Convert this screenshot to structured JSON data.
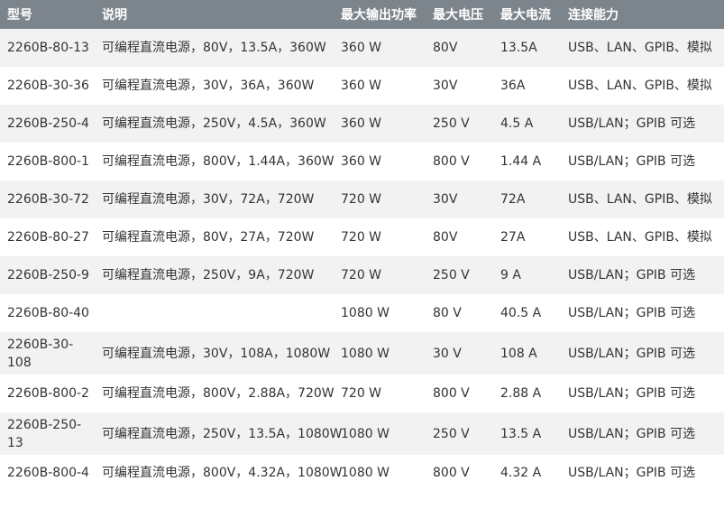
{
  "headers": [
    "型号",
    "说明",
    "最大输出功率",
    "最大电压",
    "最大电流",
    "连接能力"
  ],
  "rows": [
    [
      "2260B-80-13",
      "可编程直流电源，80V，13.5A，360W",
      "360 W",
      "80V",
      "13.5A",
      "USB、LAN、GPIB、模拟"
    ],
    [
      "2260B-30-36",
      "可编程直流电源，30V，36A，360W",
      "360 W",
      "30V",
      "36A",
      "USB、LAN、GPIB、模拟"
    ],
    [
      "2260B-250-4",
      "可编程直流电源，250V，4.5A，360W",
      "360 W",
      "250 V",
      "4.5 A",
      "USB/LAN；GPIB 可选"
    ],
    [
      "2260B-800-1",
      "可编程直流电源，800V，1.44A，360W",
      "360 W",
      "800 V",
      "1.44 A",
      "USB/LAN；GPIB 可选"
    ],
    [
      "2260B-30-72",
      "可编程直流电源，30V，72A，720W",
      "720 W",
      "30V",
      "72A",
      "USB、LAN、GPIB、模拟"
    ],
    [
      "2260B-80-27",
      "可编程直流电源，80V，27A，720W",
      "720 W",
      "80V",
      "27A",
      "USB、LAN、GPIB、模拟"
    ],
    [
      "2260B-250-9",
      "可编程直流电源，250V，9A，720W",
      "720 W",
      "250 V",
      "9 A",
      "USB/LAN；GPIB 可选"
    ],
    [
      "2260B-80-40",
      "",
      "1080 W",
      "80 V",
      "40.5 A",
      "USB/LAN；GPIB 可选"
    ],
    [
      "2260B-30-108",
      "可编程直流电源，30V，108A，1080W",
      "1080 W",
      "30 V",
      "108 A",
      "USB/LAN；GPIB 可选"
    ],
    [
      "2260B-800-2",
      "可编程直流电源，800V，2.88A，720W",
      "720 W",
      "800 V",
      "2.88 A",
      "USB/LAN；GPIB 可选"
    ],
    [
      "2260B-250-13",
      "可编程直流电源，250V，13.5A，1080W",
      "1080 W",
      "250 V",
      "13.5 A",
      "USB/LAN；GPIB 可选"
    ],
    [
      "2260B-800-4",
      "可编程直流电源，800V，4.32A，1080W",
      "1080 W",
      "800 V",
      "4.32 A",
      "USB/LAN；GPIB 可选"
    ]
  ]
}
